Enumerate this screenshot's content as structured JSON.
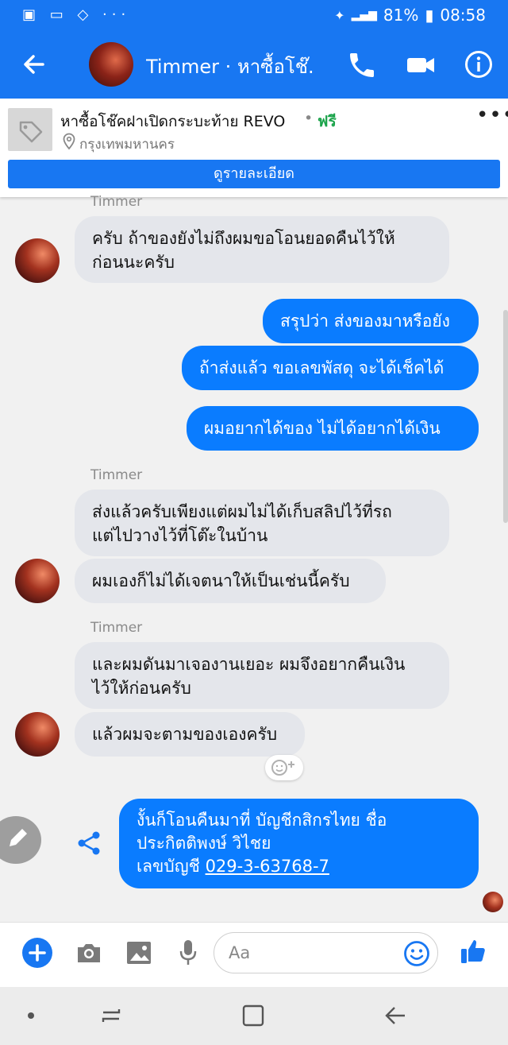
{
  "status_bar": {
    "battery": "81%",
    "time": "08:58"
  },
  "header": {
    "title": "Timmer · หาซื้อโช๊..."
  },
  "listing": {
    "title": "หาซื้อโช๊คฝาเปิดกระบะท้าย REVO",
    "separator": "•",
    "price": "ฟรี",
    "location": "กรุงเทพมหานคร",
    "details_button": "ดูรายละเอียด",
    "more": "•••"
  },
  "chat": {
    "sender": "Timmer",
    "messages": [
      {
        "dir": "in",
        "lines": [
          "ครับ ถ้าของยังไม่ถึงผมขอโอนยอดคืนไว้ให้",
          "ก่อนนะครับ"
        ]
      },
      {
        "dir": "out",
        "lines": [
          "สรุปว่า ส่งของมาหรือยัง"
        ]
      },
      {
        "dir": "out",
        "lines": [
          "ถ้าส่งแล้ว ขอเลขพัสดุ จะได้เช็คได้"
        ]
      },
      {
        "dir": "out",
        "lines": [
          "ผมอยากได้ของ ไม่ได้อยากได้เงิน"
        ]
      },
      {
        "dir": "in",
        "lines": [
          "ส่งแล้วครับเพียงแต่ผมไม่ได้เก็บสลิปไว้ที่รถ",
          "แต่ไปวางไว้ที่โต๊ะในบ้าน"
        ]
      },
      {
        "dir": "in",
        "lines": [
          "ผมเองก็ไม่ได้เจตนาให้เป็นเช่นนี้ครับ"
        ]
      },
      {
        "dir": "in",
        "lines": [
          "และผมดันมาเจองานเยอะ ผมจึงอยากคืนเงิน",
          "ไว้ให้ก่อนครับ"
        ]
      },
      {
        "dir": "in",
        "lines": [
          "แล้วผมจะตามของเองครับ"
        ]
      },
      {
        "dir": "out",
        "lines": [
          "งั้นก็โอนคืนมาที่ บัญชีกสิกรไทย ชื่อ",
          "ประกิตติพงษ์ วิไชย",
          "เลขบัญชี "
        ],
        "link": "029-3-63768-7"
      }
    ]
  },
  "composer": {
    "placeholder": "Aa"
  },
  "colors": {
    "brand": "#1877f2",
    "outgoing": "#0a7cff",
    "incoming": "#e4e6eb",
    "price": "#1aa34a"
  },
  "icons": [
    "back-arrow-icon",
    "phone-icon",
    "video-icon",
    "info-icon",
    "tag-icon",
    "location-pin-icon",
    "pencil-icon",
    "share-icon",
    "add-reaction-icon",
    "plus-icon",
    "camera-icon",
    "gallery-icon",
    "microphone-icon",
    "emoji-icon",
    "thumbs-up-icon",
    "recent-apps-icon",
    "home-icon",
    "back-nav-icon"
  ]
}
